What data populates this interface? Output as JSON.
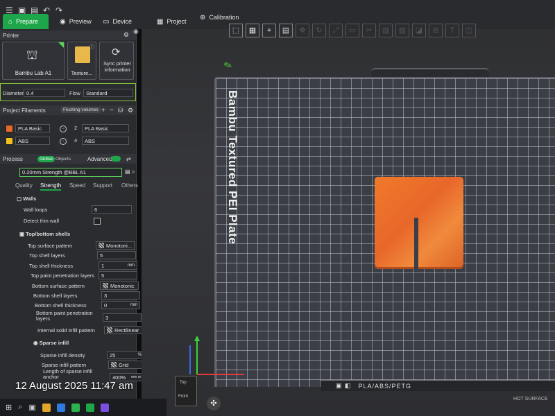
{
  "topbar": {
    "tabs": [
      {
        "label": "Prepare",
        "icon": "home-icon"
      },
      {
        "label": "Preview",
        "icon": "eye-icon"
      },
      {
        "label": "Device",
        "icon": "device-icon"
      },
      {
        "label": "Project",
        "icon": "project-icon"
      },
      {
        "label": "Calibration",
        "icon": "calibration-icon"
      }
    ]
  },
  "printer": {
    "section_title": "Printer",
    "printer_name": "Bambu Lab A1",
    "plate_name": "Texture...",
    "sync_label": "Sync printer information",
    "diameter_label": "Diameter",
    "diameter_value": "0.4",
    "flow_label": "Flow",
    "flow_value": "Standard"
  },
  "filaments": {
    "section_title": "Project Filaments",
    "flushing_label": "Flushing volumes",
    "items": [
      {
        "index": "1",
        "name": "PLA Basic",
        "color": "#e8692a"
      },
      {
        "index": "2",
        "name": "PLA Basic",
        "color": "#2e2e2e"
      },
      {
        "index": "3",
        "name": "ABS",
        "color": "#f2c21a"
      },
      {
        "index": "4",
        "name": "ABS",
        "color": "#2e2e2e"
      }
    ]
  },
  "process": {
    "section_title": "Process",
    "toggle_global": "Global",
    "toggle_objects": "Objects",
    "advanced_label": "Advanced",
    "preset": "0.20mm Strength @BBL A1",
    "subtabs": [
      "Quality",
      "Strength",
      "Speed",
      "Support",
      "Others"
    ],
    "active_subtab": "Strength"
  },
  "walls": {
    "title": "Walls",
    "wall_loops_label": "Wall loops",
    "wall_loops_value": "6",
    "detect_thin_label": "Detect thin wall"
  },
  "top_bottom": {
    "title": "Top/bottom shells",
    "rows": [
      {
        "label": "Top surface pattern",
        "value": "Monotoni...",
        "unit": ""
      },
      {
        "label": "Top shell layers",
        "value": "5",
        "unit": ""
      },
      {
        "label": "Top shell thickness",
        "value": "1",
        "unit": "mm"
      },
      {
        "label": "Top paint penetration layers",
        "value": "5",
        "unit": ""
      },
      {
        "label": "Bottom surface pattern",
        "value": "Monotonic",
        "unit": ""
      },
      {
        "label": "Bottom shell layers",
        "value": "3",
        "unit": ""
      },
      {
        "label": "Bottom shell thickness",
        "value": "0",
        "unit": "mm"
      },
      {
        "label": "Bottom paint penetration layers",
        "value": "3",
        "unit": ""
      },
      {
        "label": "Internal solid infill pattern",
        "value": "Rectilinear",
        "unit": ""
      }
    ]
  },
  "sparse": {
    "title": "Sparse infill",
    "rows": [
      {
        "label": "Sparse infill density",
        "value": "25",
        "unit": "%"
      },
      {
        "label": "Sparse infill pattern",
        "value": "Grid",
        "unit": ""
      },
      {
        "label": "Length of sparse infill anchor",
        "value": "400%",
        "unit": "mm or %"
      }
    ]
  },
  "viewport": {
    "plate_label": "Bambu Textured PEI Plate",
    "footer_text": "PLA/ABS/PETG",
    "surface_text": "HOT SURFACE",
    "view_cube_top": "Top",
    "view_cube_front": "Front"
  },
  "overlay": {
    "timestamp": "12 August 2025 11:47 am"
  }
}
